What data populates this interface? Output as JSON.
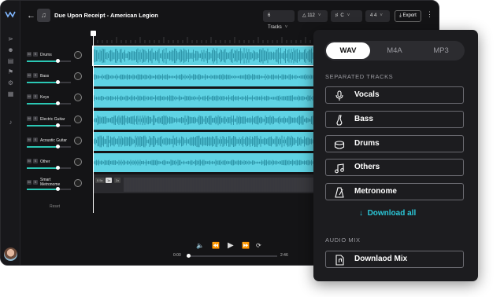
{
  "header": {
    "back_icon": "arrow-left-icon",
    "title": "Due Upon Receipt - American Legion",
    "tracks_label": "6 Tracks",
    "tempo_value": "112",
    "key_value": "C",
    "time_signature": "4 4",
    "export_label": "Export"
  },
  "tracks": [
    {
      "name": "Drums",
      "volume": 0.7
    },
    {
      "name": "Bass",
      "volume": 0.7
    },
    {
      "name": "Keys",
      "volume": 0.7
    },
    {
      "name": "Electric Guitar",
      "volume": 0.7
    },
    {
      "name": "Acoustic Guitar",
      "volume": 0.7
    },
    {
      "name": "Other",
      "volume": 0.7
    },
    {
      "name": "Smart Metronome",
      "volume": 0.7
    }
  ],
  "track_controls": {
    "mute": "M",
    "solo": "S"
  },
  "reset_label": "Reset",
  "metronome_speeds": [
    "0.5x",
    "1x",
    "2x"
  ],
  "transport": {
    "current_time": "0:00",
    "total_time": "2:46",
    "progress": 0.0
  },
  "export_panel": {
    "formats": [
      "WAV",
      "M4A",
      "MP3"
    ],
    "selected_format": "WAV",
    "separated_title": "SEPARATED TRACKS",
    "stems": [
      {
        "label": "Vocals",
        "icon": "microphone-icon"
      },
      {
        "label": "Bass",
        "icon": "bass-guitar-icon"
      },
      {
        "label": "Drums",
        "icon": "drum-icon"
      },
      {
        "label": "Others",
        "icon": "music-note-icon"
      },
      {
        "label": "Metronome",
        "icon": "metronome-icon"
      }
    ],
    "download_all": "Download all",
    "mix_title": "AUDIO MIX",
    "mix_button": "Downlaod Mix"
  },
  "colors": {
    "lane": "#5fd3e4",
    "accent": "#2bc7d8",
    "panel_bg": "#1c1c1f"
  }
}
